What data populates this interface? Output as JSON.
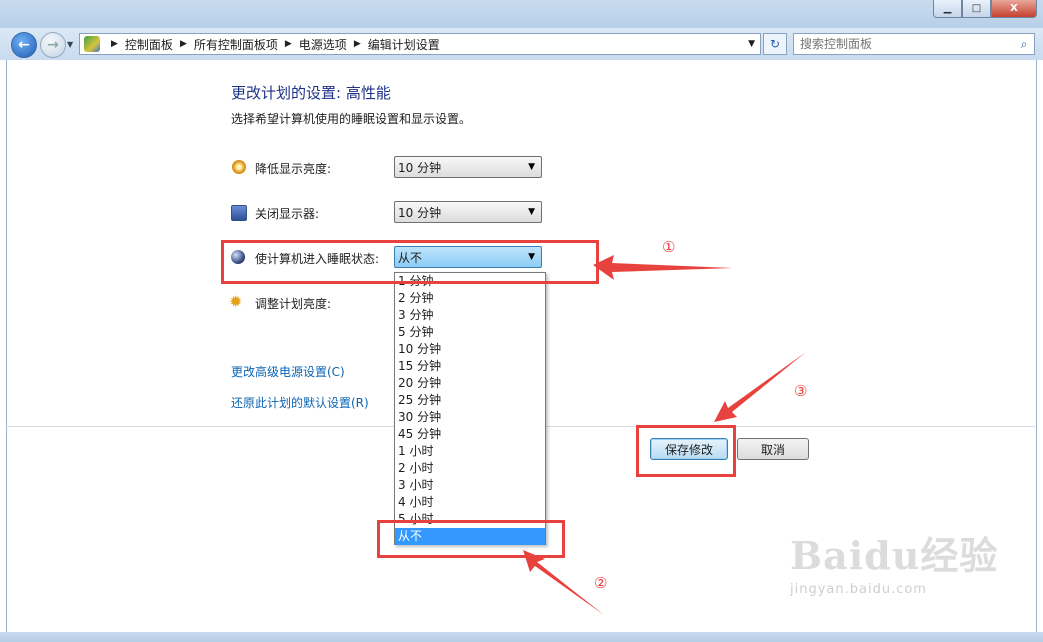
{
  "window": {
    "min_label": "▁",
    "max_label": "□",
    "close_label": "X"
  },
  "address_bar": {
    "crumbs": [
      "控制面板",
      "所有控制面板项",
      "电源选项",
      "编辑计划设置"
    ]
  },
  "search": {
    "placeholder": "搜索控制面板"
  },
  "page": {
    "heading": "更改计划的设置: 高性能",
    "subtitle": "选择希望计算机使用的睡眠设置和显示设置。"
  },
  "settings": [
    {
      "label": "降低显示亮度:",
      "value": "10 分钟",
      "icon": "brightness-icon"
    },
    {
      "label": "关闭显示器:",
      "value": "10 分钟",
      "icon": "monitor-icon"
    },
    {
      "label": "使计算机进入睡眠状态:",
      "value": "从不",
      "icon": "sleep-moon-icon"
    },
    {
      "label": "调整计划亮度:",
      "icon": "sun-icon"
    }
  ],
  "sleep_options": [
    "1 分钟",
    "2 分钟",
    "3 分钟",
    "5 分钟",
    "10 分钟",
    "15 分钟",
    "20 分钟",
    "25 分钟",
    "30 分钟",
    "45 分钟",
    "1 小时",
    "2 小时",
    "3 小时",
    "4 小时",
    "5 小时",
    "从不"
  ],
  "selected_option": "从不",
  "links": {
    "advanced": "更改高级电源设置(C)",
    "restore": "还原此计划的默认设置(R)"
  },
  "buttons": {
    "save": "保存修改",
    "cancel": "取消"
  },
  "annotations": {
    "one": "①",
    "two": "②",
    "three": "③",
    "color": "#e8423e"
  },
  "watermark": {
    "brand": "Baidu经验",
    "url": "jingyan.baidu.com"
  }
}
